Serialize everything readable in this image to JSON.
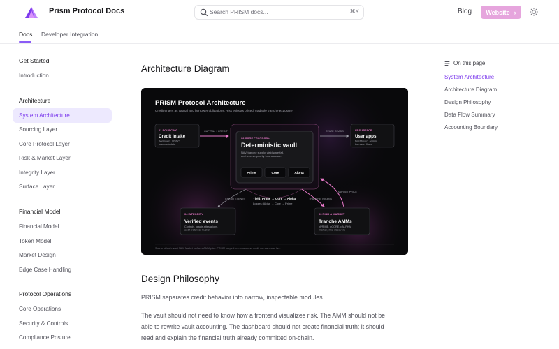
{
  "header": {
    "brand": "Prism Protocol Docs",
    "search_placeholder": "Search PRISM docs...",
    "search_shortcut": "⌘K",
    "blog_label": "Blog",
    "website_label": "Website",
    "accent": "#e6a5dd"
  },
  "tabs": [
    {
      "label": "Docs",
      "active": true
    },
    {
      "label": "Developer Integration",
      "active": false
    }
  ],
  "sidebar": {
    "groups": [
      {
        "heading": "Get Started",
        "items": [
          "Introduction"
        ]
      },
      {
        "heading": "Architecture",
        "items": [
          "System Architecture",
          "Sourcing Layer",
          "Core Protocol Layer",
          "Risk & Market Layer",
          "Integrity Layer",
          "Surface Layer"
        ]
      },
      {
        "heading": "Financial Model",
        "items": [
          "Financial Model",
          "Token Model",
          "Market Design",
          "Edge Case Handling"
        ]
      },
      {
        "heading": "Protocol Operations",
        "items": [
          "Core Operations",
          "Security & Controls",
          "Compliance Posture"
        ]
      }
    ],
    "active_item": "System Architecture"
  },
  "main": {
    "title": "Architecture Diagram",
    "section_title": "Design Philosophy",
    "para1": "PRISM separates credit behavior into narrow, inspectable modules.",
    "para2_line1": "The vault should not need to know how a frontend visualizes risk. The AMM should not be",
    "para2_line2": "able to rewrite vault accounting. The dashboard should not create financial truth; it should",
    "para2_line3": "read and explain the financial truth already committed on-chain."
  },
  "diagram": {
    "title": "PRISM Protocol Architecture",
    "subtitle": "Credit enters as capital and borrower obligations. Risk exits as priced, tradable tranche exposure.",
    "sourcing": {
      "tag": "01 SOURCING",
      "title": "Credit intake",
      "desc1": "Borrowers, USDC,",
      "desc2": "loan metadata"
    },
    "core": {
      "tag": "02 CORE PROTOCOL",
      "title": "Deterministic vault",
      "desc1": "NAV, tranche supply, yield waterfall,",
      "desc2": "and reverse-priority loss cascade.",
      "chips": [
        "Prime",
        "Core",
        "Alpha"
      ]
    },
    "surface": {
      "tag": "05 SURFACE",
      "title": "User apps",
      "desc1": "Dashboard, admin,",
      "desc2": "borrower flows"
    },
    "integrity": {
      "tag": "04 INTEGRITY",
      "title": "Verified events",
      "desc1": "Controls, oracle attestations,",
      "desc2": "audit trail, loss bucket"
    },
    "market": {
      "tag": "03 RISK & MARKET",
      "title": "Tranche AMMs",
      "desc1": "pPRIME, pCORE, pALPHA",
      "desc2": "market price discovery"
    },
    "edges": {
      "capital": "CAPITAL + CREDIT",
      "state": "STATE READS",
      "credit_events": "CREDIT EVENTS",
      "tranche_tokens": "TRANCHE TOKENS",
      "market_price": "MARKET PRICE"
    },
    "yield_line": "Yield: Prime → Core → Alpha",
    "loss_line": "Losses: Alpha → Core → Prime",
    "footer": "Source of truth: vault NAV. Market surfaces AMM price. PRISM keeps them separate so credit risk can move live."
  },
  "toc": {
    "heading": "On this page",
    "items": [
      "System Architecture",
      "Architecture Diagram",
      "Design Philosophy",
      "Data Flow Summary",
      "Accounting Boundary"
    ],
    "active": "System Architecture"
  }
}
